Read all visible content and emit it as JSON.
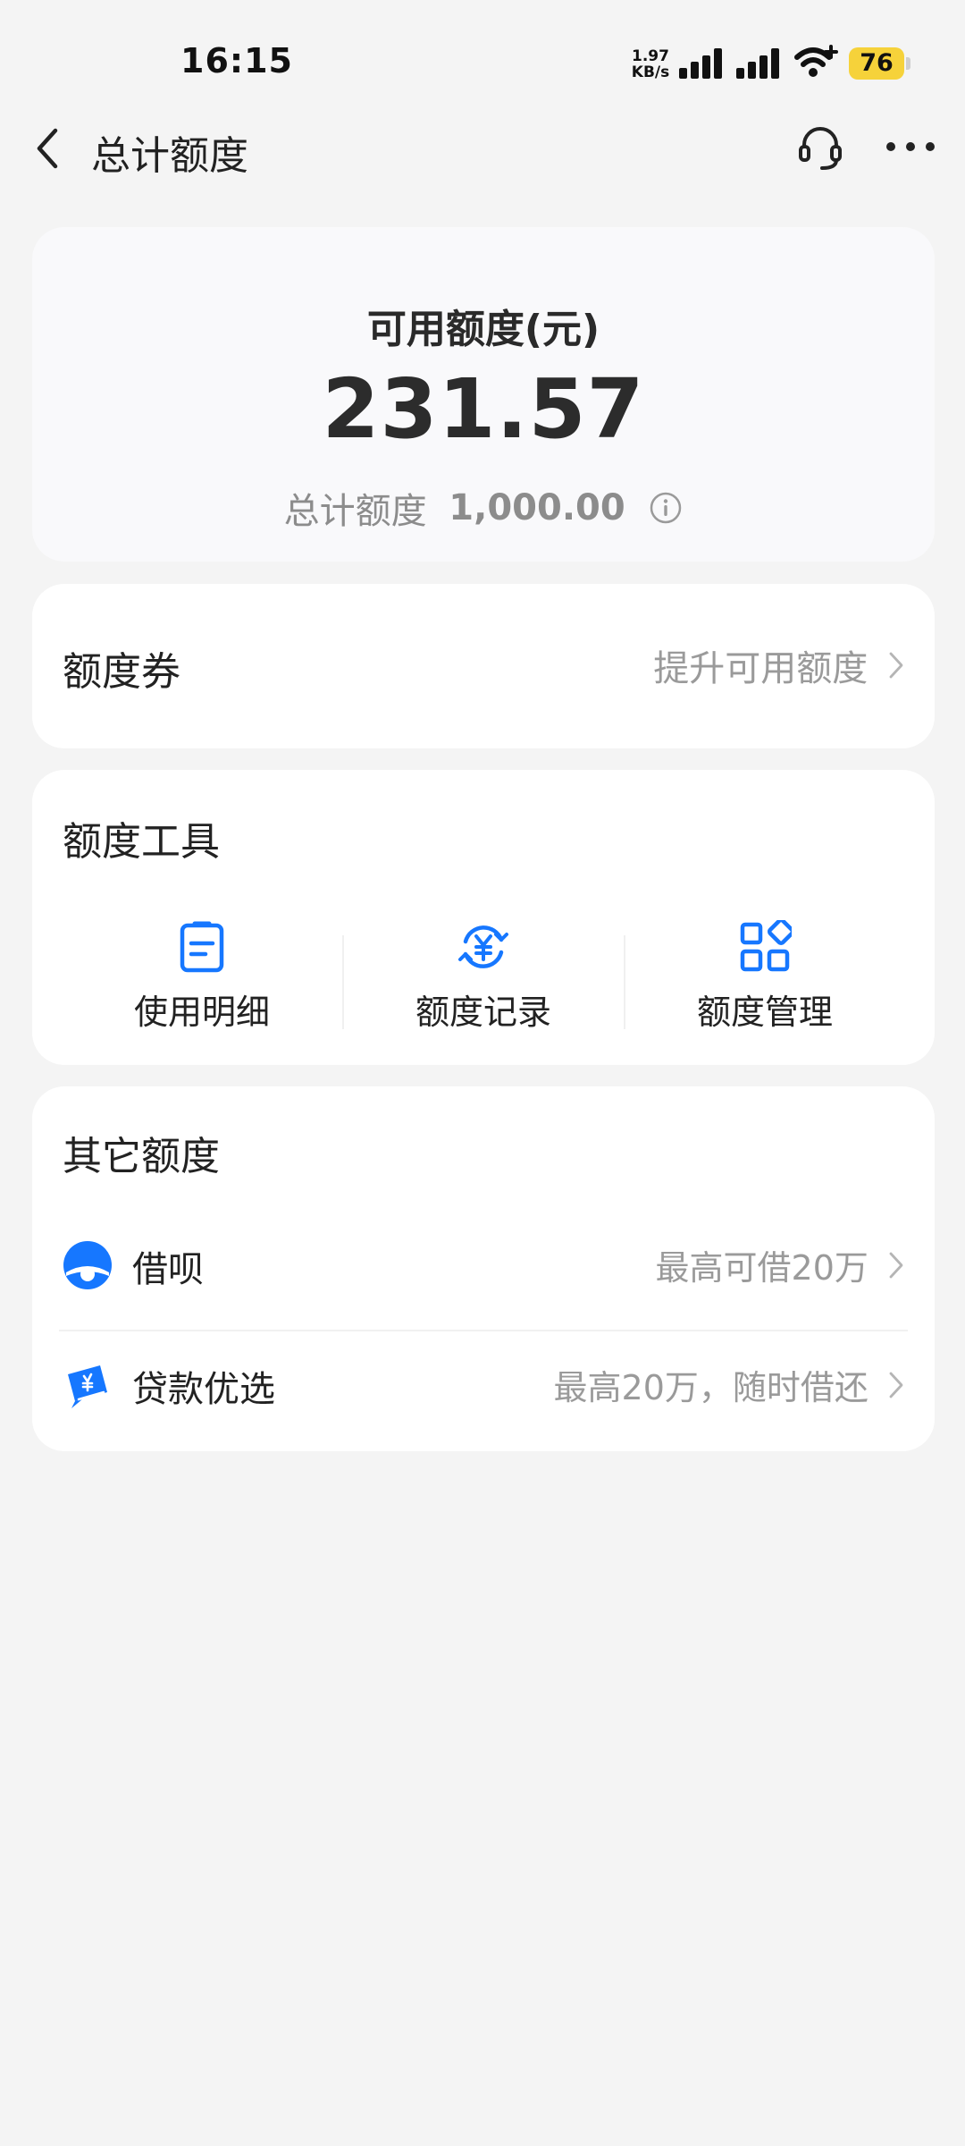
{
  "status_bar": {
    "time": "16:15",
    "net_speed_value": "1.97",
    "net_speed_unit": "KB/s",
    "battery": "76",
    "battery_color": "#f6d23a"
  },
  "header": {
    "title": "总计额度",
    "back_icon": "chevron-left",
    "service_icon": "headset",
    "more_icon": "ellipsis"
  },
  "available": {
    "label": "可用额度(元)",
    "amount": "231.57",
    "total_label": "总计额度",
    "total_amount": "1,000.00",
    "info_icon": "info-circle"
  },
  "coupon": {
    "title": "额度券",
    "action": "提升可用额度"
  },
  "tools": {
    "title": "额度工具",
    "items": [
      {
        "label": "使用明细",
        "icon": "clipboard"
      },
      {
        "label": "额度记录",
        "icon": "yen-cycle"
      },
      {
        "label": "额度管理",
        "icon": "grid-apps"
      }
    ]
  },
  "other": {
    "title": "其它额度",
    "items": [
      {
        "label": "借呗",
        "note": "最高可借20万",
        "icon": "jiebei-logo"
      },
      {
        "label": "贷款优选",
        "note": "最高20万，随时借还",
        "icon": "loan-card"
      }
    ]
  },
  "colors": {
    "accent": "#1677ff",
    "background": "#f4f4f4"
  }
}
